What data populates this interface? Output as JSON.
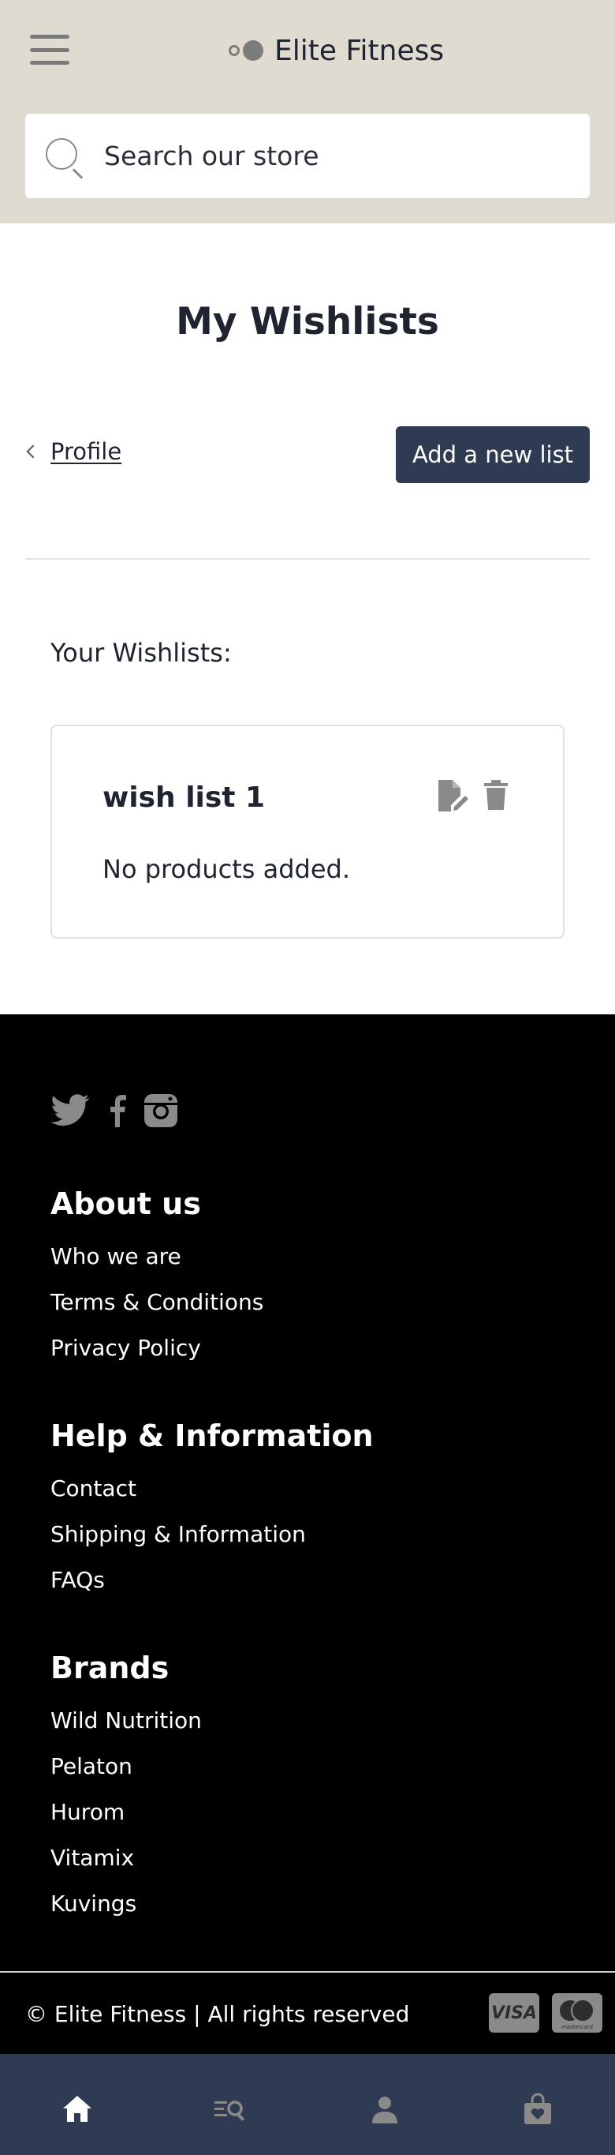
{
  "header": {
    "menu_icon": "hamburger-menu-icon",
    "brand_name": "Elite Fitness",
    "brand_logo_icon": "elite-fitness-logo-icon",
    "search": {
      "placeholder": "Search our store",
      "icon": "search-icon"
    },
    "background_color": "#dfdbd0"
  },
  "main": {
    "title": "My Wishlists",
    "back_link": {
      "label": "Profile",
      "icon": "chevron-left-icon"
    },
    "add_button": {
      "label": "Add a new list",
      "color": "#2f3b52"
    },
    "wishlists_heading": "Your Wishlists:",
    "wishlists": [
      {
        "name": "wish list 1",
        "status": "No products added.",
        "edit_icon": "edit-document-icon",
        "delete_icon": "trash-icon"
      }
    ]
  },
  "footer": {
    "social_icons": [
      "twitter-icon",
      "facebook-icon",
      "instagram-icon"
    ],
    "sections": [
      {
        "title": "About us",
        "links": [
          "Who we are",
          "Terms & Conditions",
          "Privacy Policy"
        ]
      },
      {
        "title": "Help & Information",
        "links": [
          "Contact",
          "Shipping & Information",
          "FAQs"
        ]
      },
      {
        "title": "Brands",
        "links": [
          "Wild Nutrition",
          "Pelaton",
          "Hurom",
          "Vitamix",
          "Kuvings"
        ]
      }
    ],
    "copyright": "© Elite Fitness | All rights reserved",
    "payments": {
      "visa": "VISA",
      "mastercard": "mastercard"
    }
  },
  "bottom_nav": {
    "items": [
      "home-icon",
      "search-list-icon",
      "account-icon",
      "shopping-bag-icon"
    ],
    "background_color": "#2f3b52"
  }
}
